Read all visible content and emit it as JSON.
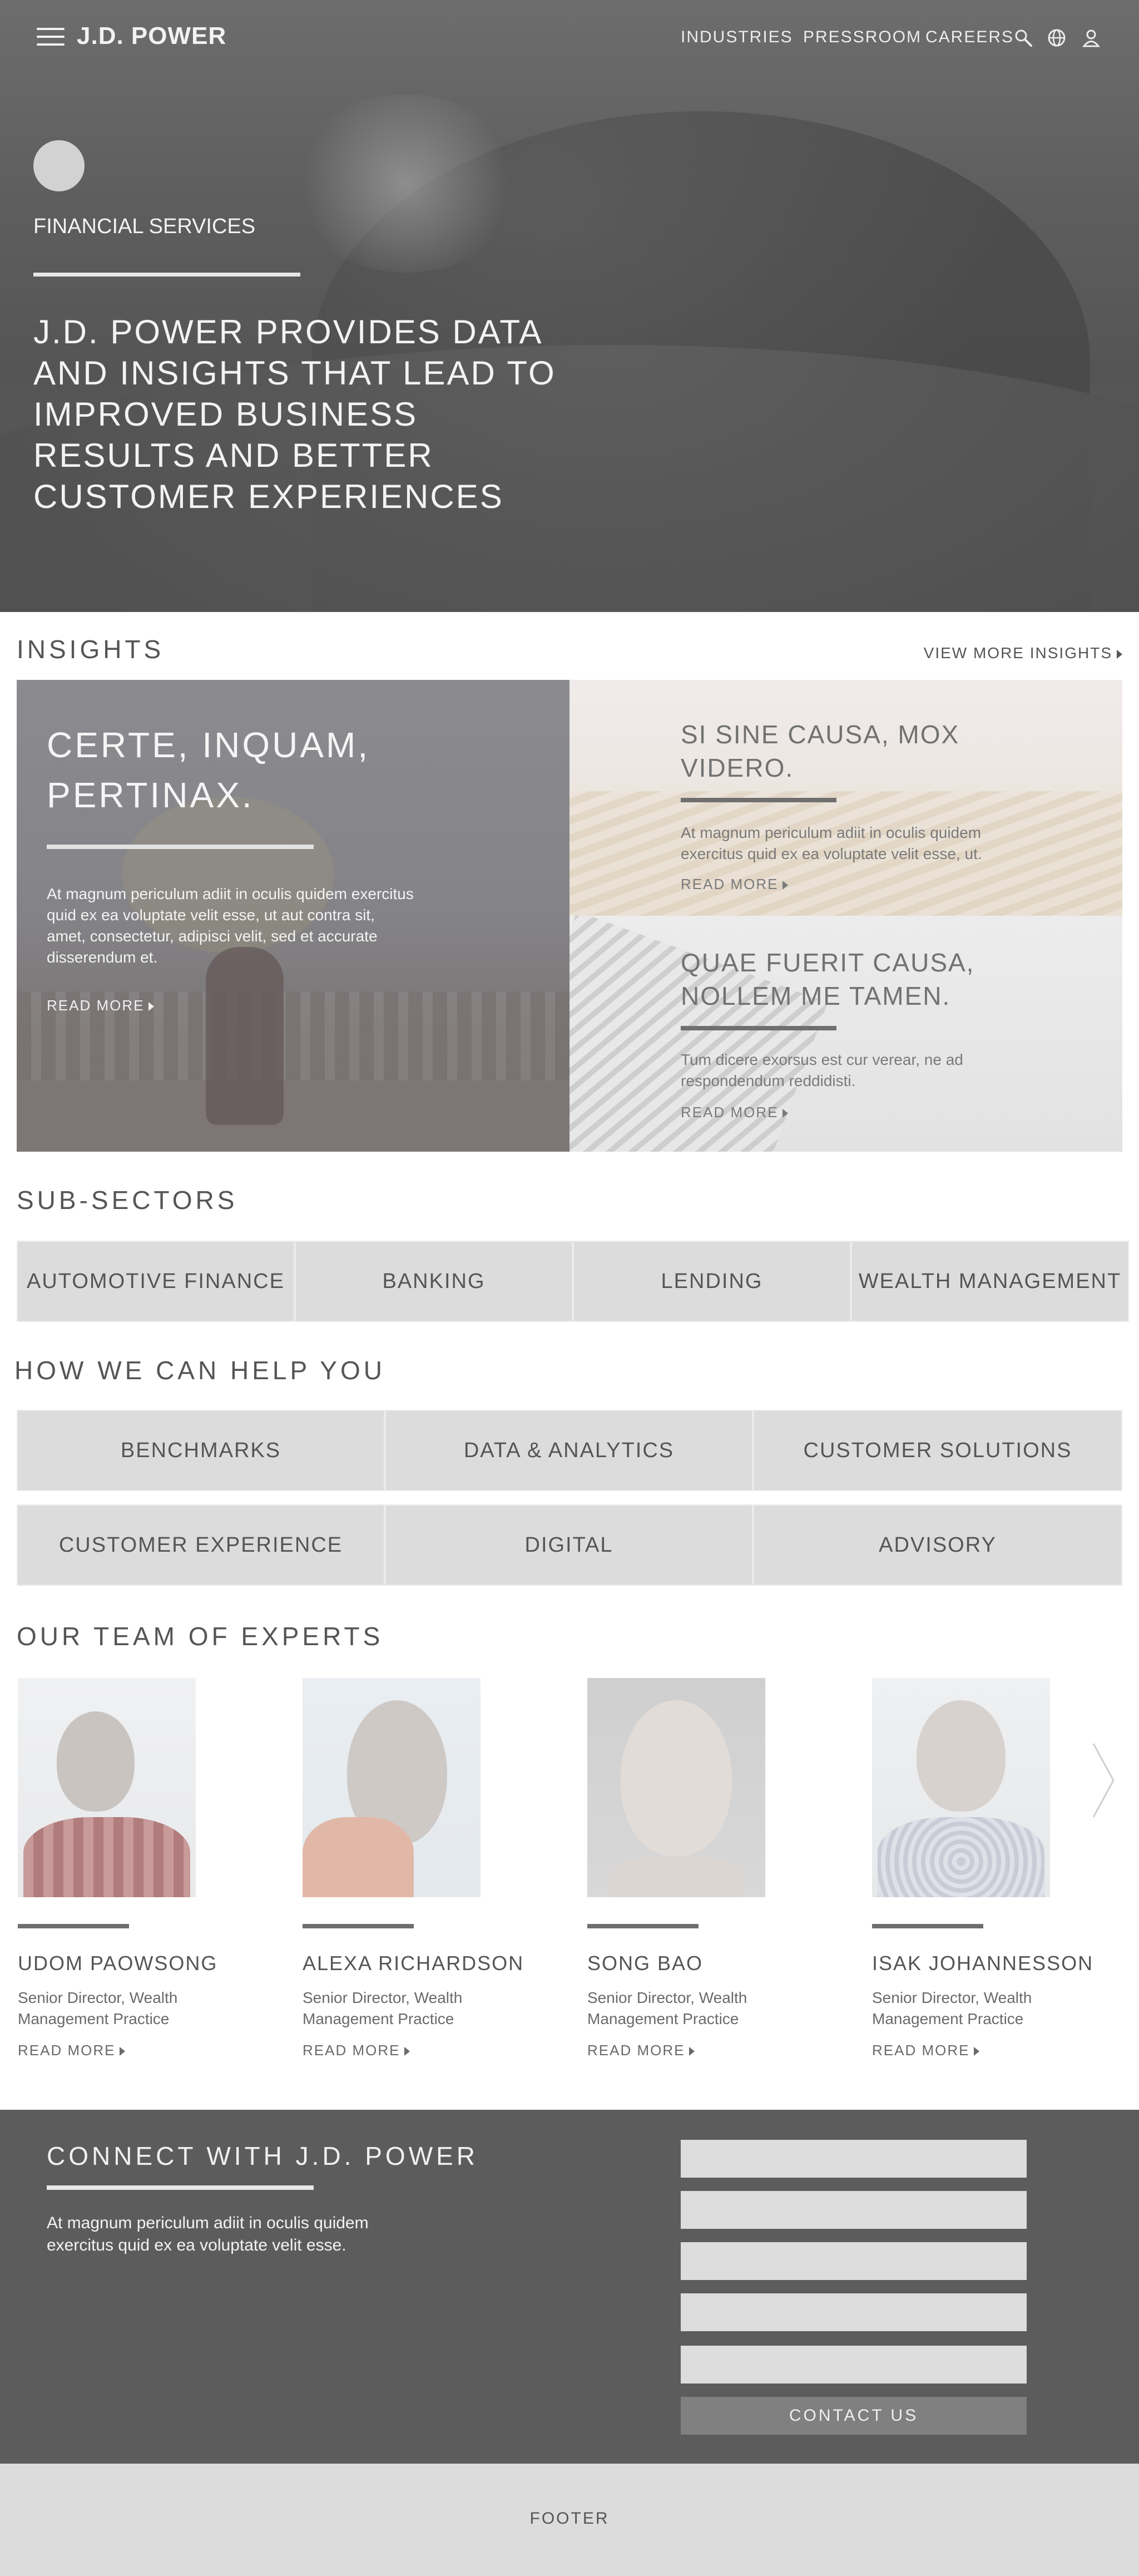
{
  "header": {
    "logo": "J.D. POWER",
    "nav": [
      "INDUSTRIES",
      "PRESSROOM",
      "CAREERS"
    ],
    "icons": [
      "menu-icon",
      "search-icon",
      "globe-icon",
      "user-icon"
    ]
  },
  "hero": {
    "eyebrow": "FINANCIAL SERVICES",
    "title": "J.D. POWER PROVIDES DATA AND INSIGHTS THAT LEAD TO IMPROVED BUSINESS RESULTS AND BETTER CUSTOMER EXPERIENCES"
  },
  "insights": {
    "heading": "INSIGHTS",
    "view_more": "VIEW MORE INSIGHTS",
    "featured": {
      "title": "CERTE, INQUAM, PERTINAX.",
      "text": "At magnum periculum adiit in oculis quidem exercitus quid ex ea voluptate velit esse, ut aut contra sit, amet, consectetur, adipisci velit, sed et accurate disserendum et.",
      "read_more": "READ MORE"
    },
    "secondary": [
      {
        "title": "SI SINE CAUSA, MOX VIDERO.",
        "text": "At magnum periculum adiit in oculis quidem exercitus quid ex ea voluptate velit esse, ut.",
        "read_more": "READ MORE"
      },
      {
        "title": "QUAE FUERIT CAUSA, NOLLEM ME TAMEN.",
        "text": "Tum dicere exorsus est cur verear, ne ad respondendum reddidisti.",
        "read_more": "READ MORE"
      }
    ]
  },
  "subsectors": {
    "heading": "SUB-SECTORS",
    "items": [
      "AUTOMOTIVE FINANCE",
      "BANKING",
      "LENDING",
      "WEALTH MANAGEMENT"
    ]
  },
  "help": {
    "heading": "HOW WE CAN HELP YOU",
    "items": [
      "BENCHMARKS",
      "DATA & ANALYTICS",
      "CUSTOMER SOLUTIONS",
      "CUSTOMER EXPERIENCE",
      "DIGITAL",
      "ADVISORY"
    ]
  },
  "experts": {
    "heading": "OUR TEAM OF EXPERTS",
    "people": [
      {
        "name": "UDOM PAOWSONG",
        "role": "Senior Director, Wealth Management Practice",
        "read_more": "READ MORE"
      },
      {
        "name": "ALEXA RICHARDSON",
        "role": "Senior Director, Wealth Management Practice",
        "read_more": "READ MORE"
      },
      {
        "name": "SONG BAO",
        "role": "Senior Director, Wealth Management Practice",
        "read_more": "READ MORE"
      },
      {
        "name": "ISAK JOHANNESSON",
        "role": "Senior Director, Wealth Management Practice",
        "read_more": "READ MORE"
      }
    ]
  },
  "connect": {
    "heading": "CONNECT WITH J.D. POWER",
    "text": "At magnum periculum adiit in oculis quidem exercitus quid ex ea voluptate velit esse.",
    "button": "CONTACT US"
  },
  "footer": {
    "label": "FOOTER"
  },
  "colors": {
    "hero_overlay": "#5f5f5f",
    "connect_bg": "#5c5c5c",
    "tile_bg": "#dcdcdc",
    "button_bg": "#808080"
  }
}
